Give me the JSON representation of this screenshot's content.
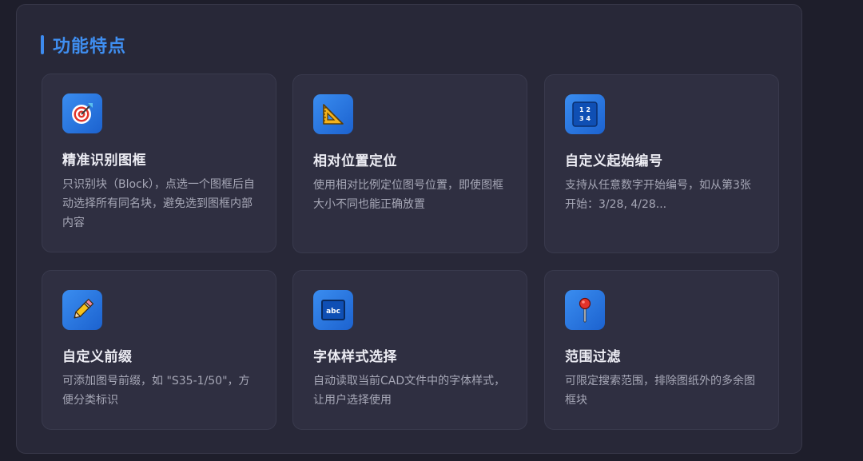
{
  "section": {
    "title": "功能特点"
  },
  "features": [
    {
      "icon": "target-icon",
      "title": "精准识别图框",
      "desc": "只识别块（Block），点选一个图框后自动选择所有同名块，避免选到图框内部内容"
    },
    {
      "icon": "triangle-ruler-icon",
      "title": "相对位置定位",
      "desc": "使用相对比例定位图号位置，即使图框大小不同也能正确放置"
    },
    {
      "icon": "number-grid-icon",
      "icon_text": [
        "1 2",
        "3 4"
      ],
      "title": "自定义起始编号",
      "desc": "支持从任意数字开始编号，如从第3张开始：3/28, 4/28..."
    },
    {
      "icon": "pencil-icon",
      "title": "自定义前缀",
      "desc": "可添加图号前缀，如 \"S35-1/50\"，方便分类标识"
    },
    {
      "icon": "abc-font-icon",
      "icon_text": "abc",
      "title": "字体样式选择",
      "desc": "自动读取当前CAD文件中的字体样式，让用户选择使用"
    },
    {
      "icon": "pushpin-icon",
      "title": "范围过滤",
      "desc": "可限定搜索范围，排除图纸外的多余图框块"
    }
  ],
  "colors": {
    "accent": "#3f8ef0",
    "background": "#1e1e2b",
    "panel": "#282838",
    "card": "#2f2f41"
  }
}
